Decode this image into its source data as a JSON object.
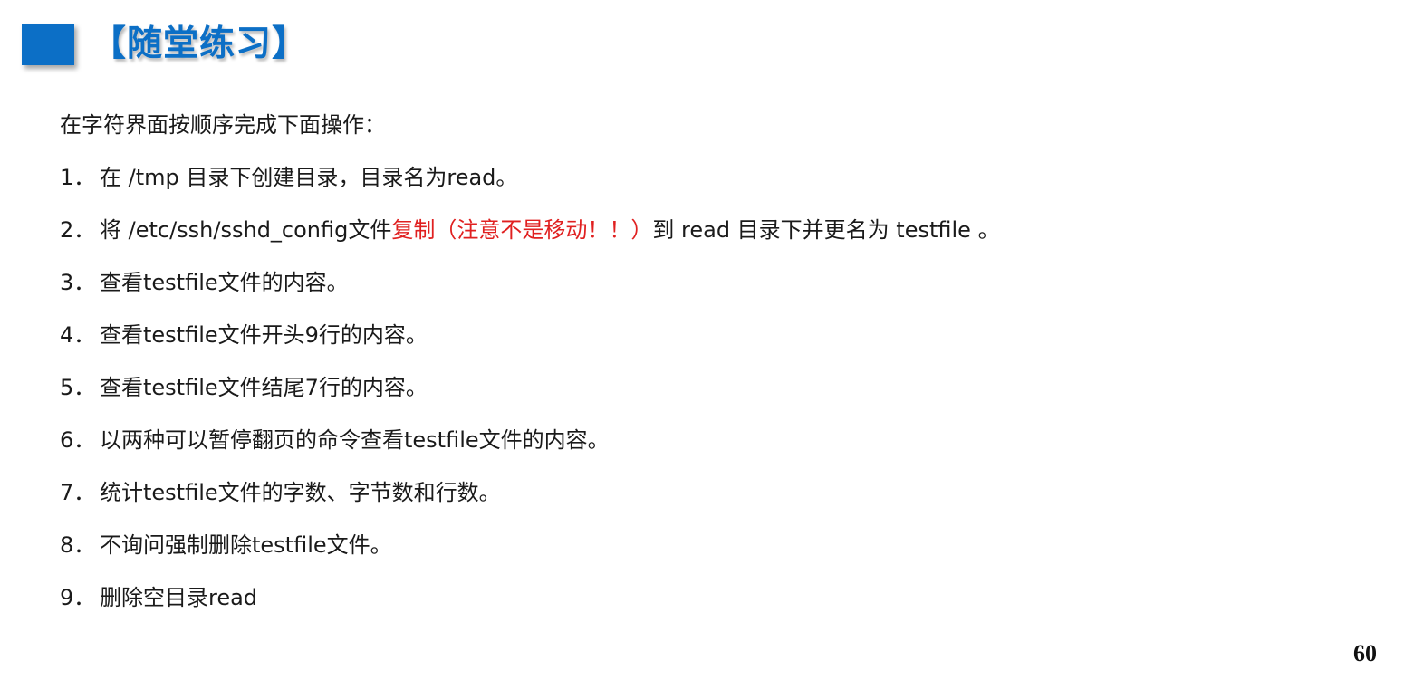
{
  "header": {
    "title": "【随堂练习】",
    "accent_color": "#0c6fc6"
  },
  "intro": "在字符界面按顺序完成下面操作：",
  "steps": [
    {
      "num": "1．",
      "text": "在 /tmp 目录下创建目录，目录名为read。"
    },
    {
      "num": "2．",
      "text_before": "将 /etc/ssh/sshd_config文件",
      "text_red": "复制（注意不是移动！！）",
      "text_after": "到  read 目录下并更名为 testfile 。",
      "highlight_color": "#e02020"
    },
    {
      "num": "3．",
      "text": "查看testfile文件的内容。"
    },
    {
      "num": "4．",
      "text": "查看testfile文件开头9行的内容。"
    },
    {
      "num": "5．",
      "text": "查看testfile文件结尾7行的内容。"
    },
    {
      "num": "6．",
      "text": "以两种可以暂停翻页的命令查看testfile文件的内容。"
    },
    {
      "num": "7．",
      "text": "统计testfile文件的字数、字节数和行数。"
    },
    {
      "num": "8．",
      "text": "不询问强制删除testfile文件。"
    },
    {
      "num": "9．",
      "text": "删除空目录read"
    }
  ],
  "page_number": "60"
}
